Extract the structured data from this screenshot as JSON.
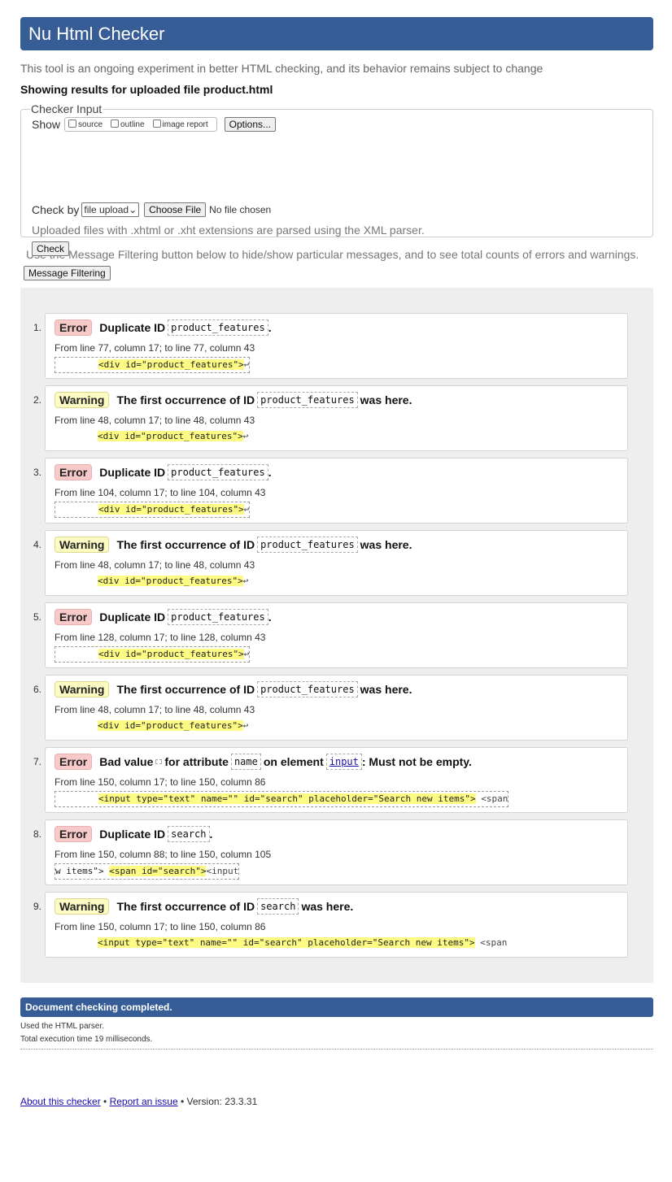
{
  "header": {
    "title": "Nu Html Checker"
  },
  "intro": "This tool is an ongoing experiment in better HTML checking, and its behavior remains subject to change",
  "showing": "Showing results for uploaded file product.html",
  "checker_input": {
    "legend": "Checker Input",
    "show_label": "Show",
    "show_options": [
      "source",
      "outline",
      "image report"
    ],
    "options_button": "Options...",
    "check_by_label": "Check by",
    "check_by_value": "file upload",
    "choose_file_button": "Choose File",
    "no_file_text": "No file chosen",
    "xml_note": "Uploaded files with .xhtml or .xht extensions are parsed using the XML parser.",
    "check_button": "Check"
  },
  "filter": {
    "text": "Use the Message Filtering button below to hide/show particular messages, and to see total counts of errors and warnings.",
    "button": "Message Filtering"
  },
  "messages": [
    {
      "num": "1.",
      "type": "Error",
      "pre": "Duplicate ID",
      "id": "product_features",
      "post": ".",
      "location": "From line 77, column 17; to line 77, column 43",
      "extract_lead": "        ",
      "extract_hl": "<div id=\"product_features\">",
      "extract_tail": "↩",
      "dashed": true
    },
    {
      "num": "2.",
      "type": "Warning",
      "pre": "The first occurrence of ID",
      "id": "product_features",
      "post": "was here.",
      "location": "From line 48, column 17; to line 48, column 43",
      "extract_lead": "        ",
      "extract_hl": "<div id=\"product_features\">",
      "extract_tail": "↩",
      "dashed": false
    },
    {
      "num": "3.",
      "type": "Error",
      "pre": "Duplicate ID",
      "id": "product_features",
      "post": ".",
      "location": "From line 104, column 17; to line 104, column 43",
      "extract_lead": "        ",
      "extract_hl": "<div id=\"product_features\">",
      "extract_tail": "↩",
      "dashed": true
    },
    {
      "num": "4.",
      "type": "Warning",
      "pre": "The first occurrence of ID",
      "id": "product_features",
      "post": "was here.",
      "location": "From line 48, column 17; to line 48, column 43",
      "extract_lead": "        ",
      "extract_hl": "<div id=\"product_features\">",
      "extract_tail": "↩",
      "dashed": false
    },
    {
      "num": "5.",
      "type": "Error",
      "pre": "Duplicate ID",
      "id": "product_features",
      "post": ".",
      "location": "From line 128, column 17; to line 128, column 43",
      "extract_lead": "        ",
      "extract_hl": "<div id=\"product_features\">",
      "extract_tail": "↩",
      "dashed": true
    },
    {
      "num": "6.",
      "type": "Warning",
      "pre": "The first occurrence of ID",
      "id": "product_features",
      "post": "was here.",
      "location": "From line 48, column 17; to line 48, column 43",
      "extract_lead": "        ",
      "extract_hl": "<div id=\"product_features\">",
      "extract_tail": "↩",
      "dashed": false
    },
    {
      "num": "7.",
      "type": "Error",
      "pre": "Bad value",
      "id": "",
      "mid": "for attribute",
      "id2": "name",
      "mid2": "on element",
      "id3": "input",
      "post": ": Must not be empty.",
      "location": "From line 150, column 17; to line 150, column 86",
      "extract_lead": "        ",
      "extract_hl": "<input type=\"text\" name=\"\" id=\"search\" placeholder=\"Search new items\">",
      "extract_tail": " <span",
      "dashed": true
    },
    {
      "num": "8.",
      "type": "Error",
      "pre": "Duplicate ID",
      "id": "search",
      "post": ".",
      "location": "From line 150, column 88; to line 150, column 105",
      "extract_lead": "w items\"> ",
      "extract_hl": "<span id=\"search\">",
      "extract_tail": "<input",
      "dashed": true
    },
    {
      "num": "9.",
      "type": "Warning",
      "pre": "The first occurrence of ID",
      "id": "search",
      "post": "was here.",
      "location": "From line 150, column 17; to line 150, column 86",
      "extract_lead": "        ",
      "extract_hl": "<input type=\"text\" name=\"\" id=\"search\" placeholder=\"Search new items\">",
      "extract_tail": " <span",
      "dashed": false
    }
  ],
  "done": "Document checking completed.",
  "parser_note": "Used the HTML parser.",
  "exec_time": "Total execution time 19 milliseconds.",
  "footer": {
    "about": "About this checker",
    "sep1": " • ",
    "report": "Report an issue",
    "version": " • Version: 23.3.31"
  },
  "colors": {
    "header_bg": "#365d95",
    "error_badge": "#f7c9c9",
    "warning_badge": "#fdfbc4",
    "highlight": "#fdfb84"
  }
}
